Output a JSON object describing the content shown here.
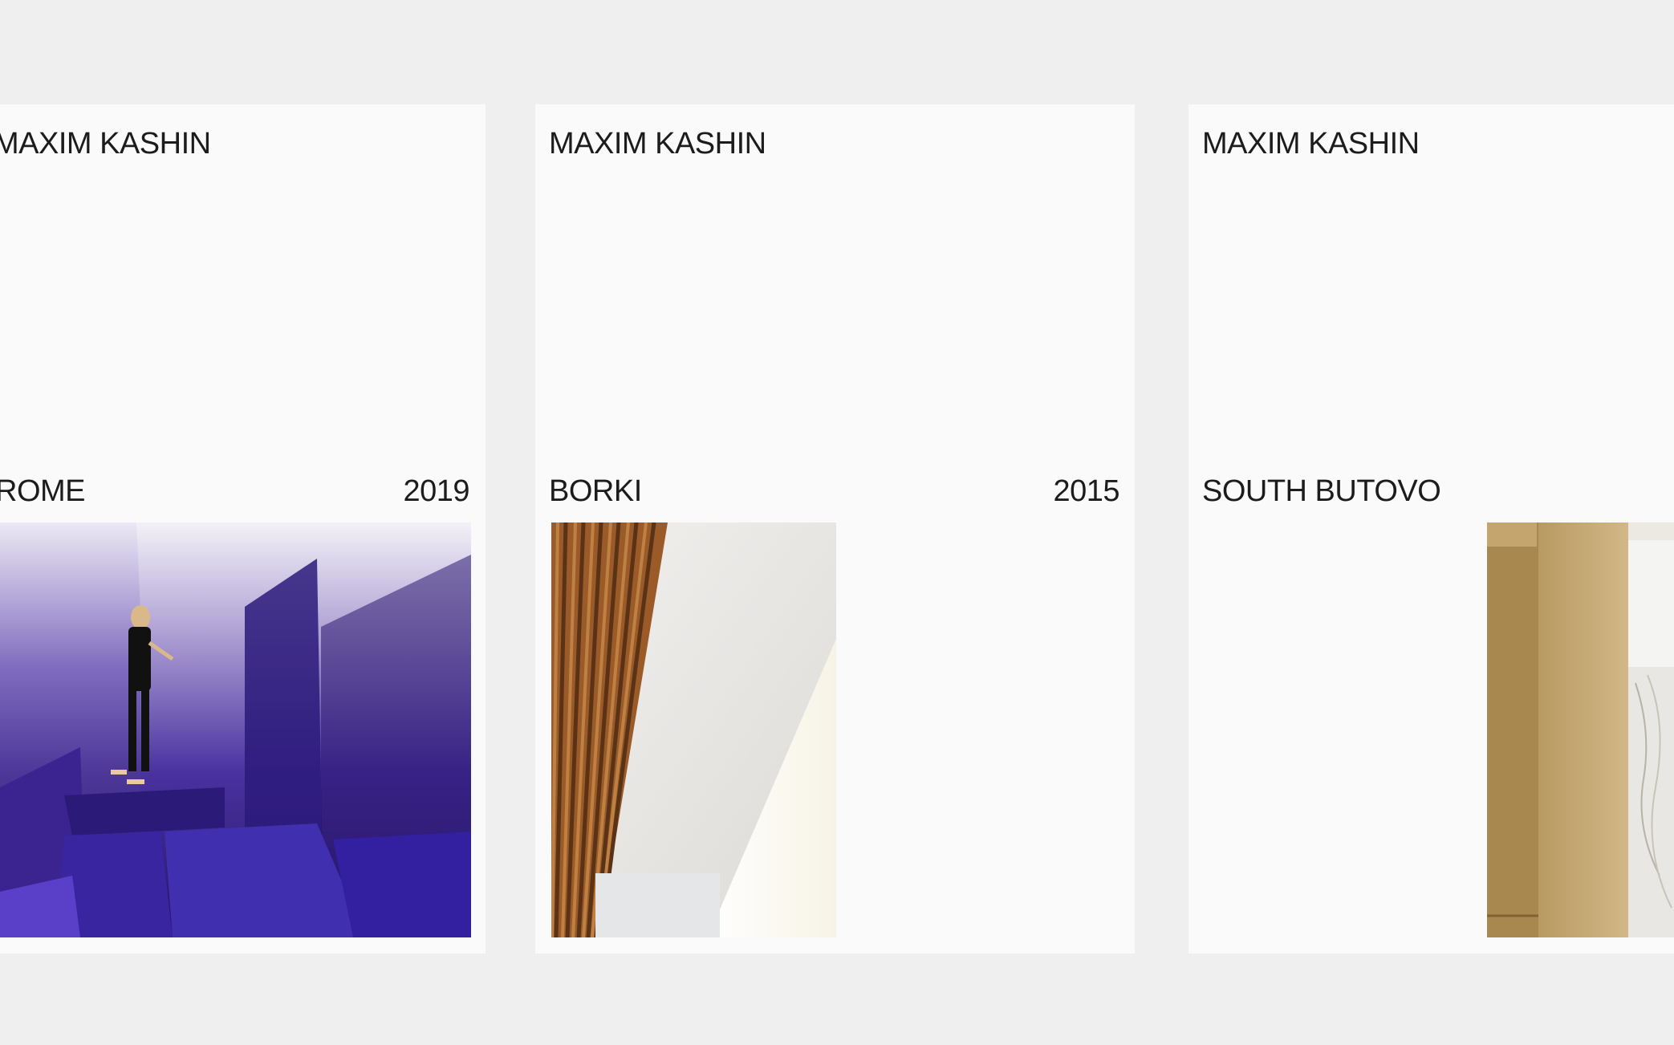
{
  "cards": [
    {
      "brand": "MAXIM KASHIN",
      "project": "ROME",
      "year": "2019",
      "image_icon": "purple-interior-photo"
    },
    {
      "brand": "MAXIM KASHIN",
      "project": "BORKI",
      "year": "2015",
      "image_icon": "wood-slat-interior-photo"
    },
    {
      "brand": "MAXIM KASHIN",
      "project": "SOUTH BUTOVO",
      "year": "",
      "image_icon": "wood-marble-interior-photo"
    }
  ],
  "colors": {
    "page_background": "#efefef",
    "card_background": "#fafafa",
    "text": "#1c1c1c",
    "accent_purple": "#3a2790"
  }
}
